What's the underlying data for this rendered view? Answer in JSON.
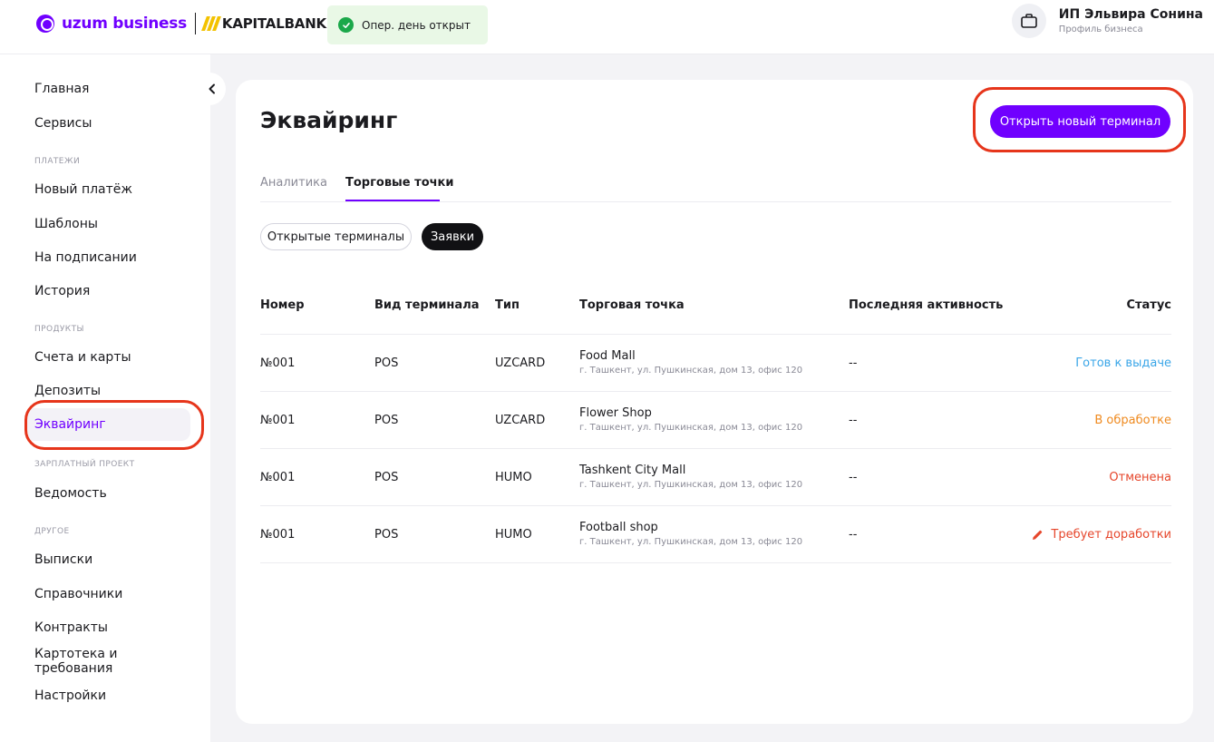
{
  "header": {
    "logo_text": "uzum business",
    "bank_text": "KAPITALBANK",
    "oper_status": "Опер. день открыт",
    "profile_name": "ИП Эльвира Сонина",
    "profile_sub": "Профиль бизнеса",
    "icons": [
      "uzum-logo-icon",
      "check-circle-icon",
      "briefcase-icon"
    ]
  },
  "sidebar": {
    "items": [
      {
        "label": "Главная"
      },
      {
        "label": "Сервисы"
      },
      {
        "section": "ПЛАТЕЖИ"
      },
      {
        "label": "Новый платёж"
      },
      {
        "label": "Шаблоны"
      },
      {
        "label": "На подписании"
      },
      {
        "label": "История"
      },
      {
        "section": "ПРОДУКТЫ"
      },
      {
        "label": "Счета и карты"
      },
      {
        "label": "Депозиты"
      },
      {
        "label": "Эквайринг"
      },
      {
        "section": "ЗАРПЛАТНЫЙ ПРОЕКТ"
      },
      {
        "label": "Ведомость"
      },
      {
        "section": "ДРУГОЕ"
      },
      {
        "label": "Выписки"
      },
      {
        "label": "Справочники"
      },
      {
        "label": "Контракты"
      },
      {
        "label": "Картотека и требования"
      },
      {
        "label": "Настройки"
      }
    ],
    "active": "Эквайринг"
  },
  "main": {
    "title": "Эквайринг",
    "open_button": "Открыть новый терминал",
    "tabs": [
      {
        "label": "Аналитика"
      },
      {
        "label": "Торговые точки"
      }
    ],
    "active_tab": "Торговые точки",
    "chips": [
      {
        "label": "Открытые терминалы"
      },
      {
        "label": "Заявки"
      }
    ],
    "active_chip": "Заявки",
    "table": {
      "headers": {
        "number": "Номер",
        "kind": "Вид терминала",
        "type": "Тип",
        "point": "Торговая точка",
        "activity": "Последняя активность",
        "status": "Статус"
      },
      "rows": [
        {
          "number": "№001",
          "kind": "POS",
          "type": "UZCARD",
          "point": "Food Mall",
          "address": "г. Ташкент, ул. Пушкинская, дом 13, офис 120",
          "activity": "--",
          "status": "Готов к выдаче",
          "status_color": "#3aa6e8"
        },
        {
          "number": "№001",
          "kind": "POS",
          "type": "UZCARD",
          "point": "Flower Shop",
          "address": "г. Ташкент, ул. Пушкинская, дом 13, офис 120",
          "activity": "--",
          "status": "В обработке",
          "status_color": "#ef8a1f"
        },
        {
          "number": "№001",
          "kind": "POS",
          "type": "HUMO",
          "point": "Tashkent City Mall",
          "address": "г. Ташкент, ул. Пушкинская, дом 13, офис 120",
          "activity": "--",
          "status": "Отменена",
          "status_color": "#e6462b"
        },
        {
          "number": "№001",
          "kind": "POS",
          "type": "HUMO",
          "point": "Football shop",
          "address": "г. Ташкент, ул. Пушкинская, дом 13, офис 120",
          "activity": "--",
          "status": "Требует доработки",
          "status_color": "#e6462b",
          "status_icon": "pencil-icon"
        }
      ]
    }
  },
  "colors": {
    "accent": "#7000ff",
    "highlight": "#e6351b",
    "success": "#1ba84a"
  }
}
